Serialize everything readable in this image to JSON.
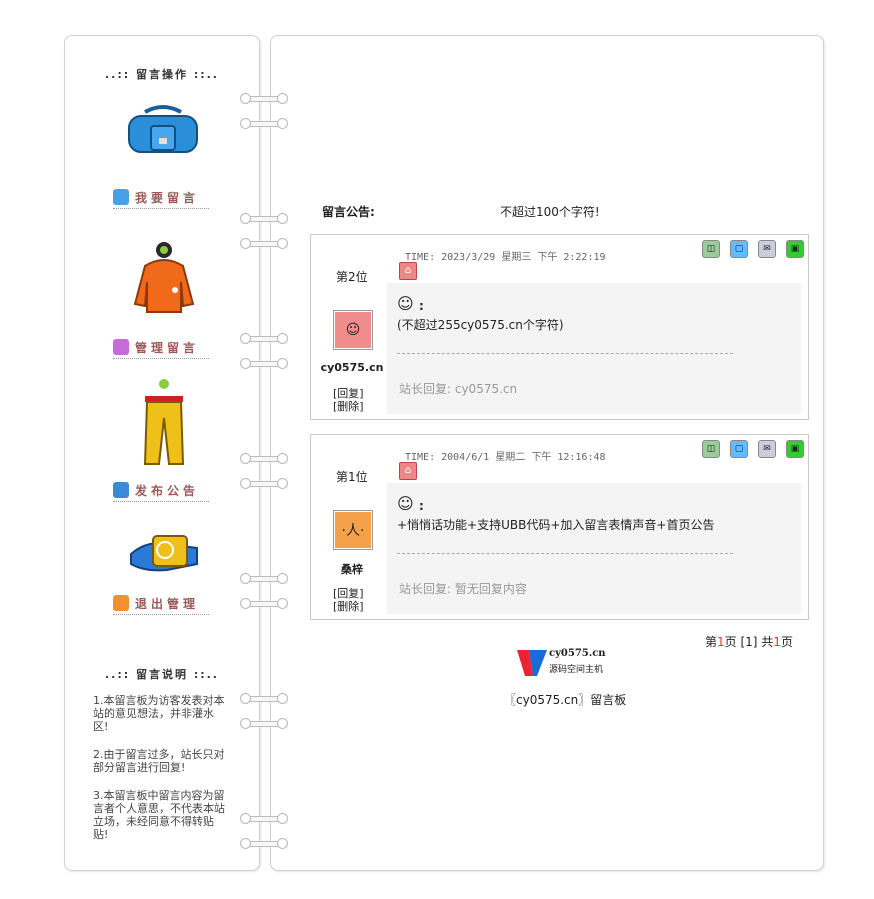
{
  "sidebar": {
    "ops_title": "..:: 留言操作 ::..",
    "menu": [
      {
        "label": "我要留言",
        "icon": "write-icon",
        "color": "#4aa0e6"
      },
      {
        "label": "管理留言",
        "icon": "chart-icon",
        "color": "#c86ad8"
      },
      {
        "label": "发布公告",
        "icon": "publish-icon",
        "color": "#3a8ad8"
      },
      {
        "label": "退出管理",
        "icon": "exit-icon",
        "color": "#f09030"
      }
    ],
    "rules_title": "..:: 留言说明 ::..",
    "rules": [
      "1.本留言板为访客发表对本站的意见想法，并非灌水区!",
      "2.由于留言过多，站长只对部分留言进行回复!",
      "3.本留言板中留言内容为留言者个人意思，不代表本站立场，未经同意不得转贴贴!"
    ]
  },
  "notice": {
    "label": "留言公告:",
    "text": "不超过100个字符!"
  },
  "messages": [
    {
      "floor_prefix": "第",
      "floor_num": "2",
      "floor_suffix": "位",
      "time": "TIME: 2023/3/29 星期三 下午 2:22:19",
      "user": "cy0575.cn",
      "reply_btn": "[回复]",
      "delete_btn": "[删除]",
      "content": "(不超过255cy0575.cn个字符)",
      "reply": "站长回复: cy0575.cn",
      "avatar_color": "#f08c8c"
    },
    {
      "floor_prefix": "第",
      "floor_num": "1",
      "floor_suffix": "位",
      "time": "TIME: 2004/6/1 星期二 下午 12:16:48",
      "user": "桑梓",
      "reply_btn": "[回复]",
      "delete_btn": "[删除]",
      "content": "+悄悄话功能+支持UBB代码+加入留言表情声音+首页公告",
      "reply": "站长回复: 暂无回复内容",
      "avatar_color": "#f5a04a"
    }
  ],
  "pager": {
    "prefix": "第",
    "page": "1",
    "mid": "页  [1]  共",
    "total": "1",
    "suffix": "页"
  },
  "logo": {
    "line1": "cy0575.cn",
    "line2": "源码空间主机"
  },
  "footer": "〖cy0575.cn〗留言板"
}
